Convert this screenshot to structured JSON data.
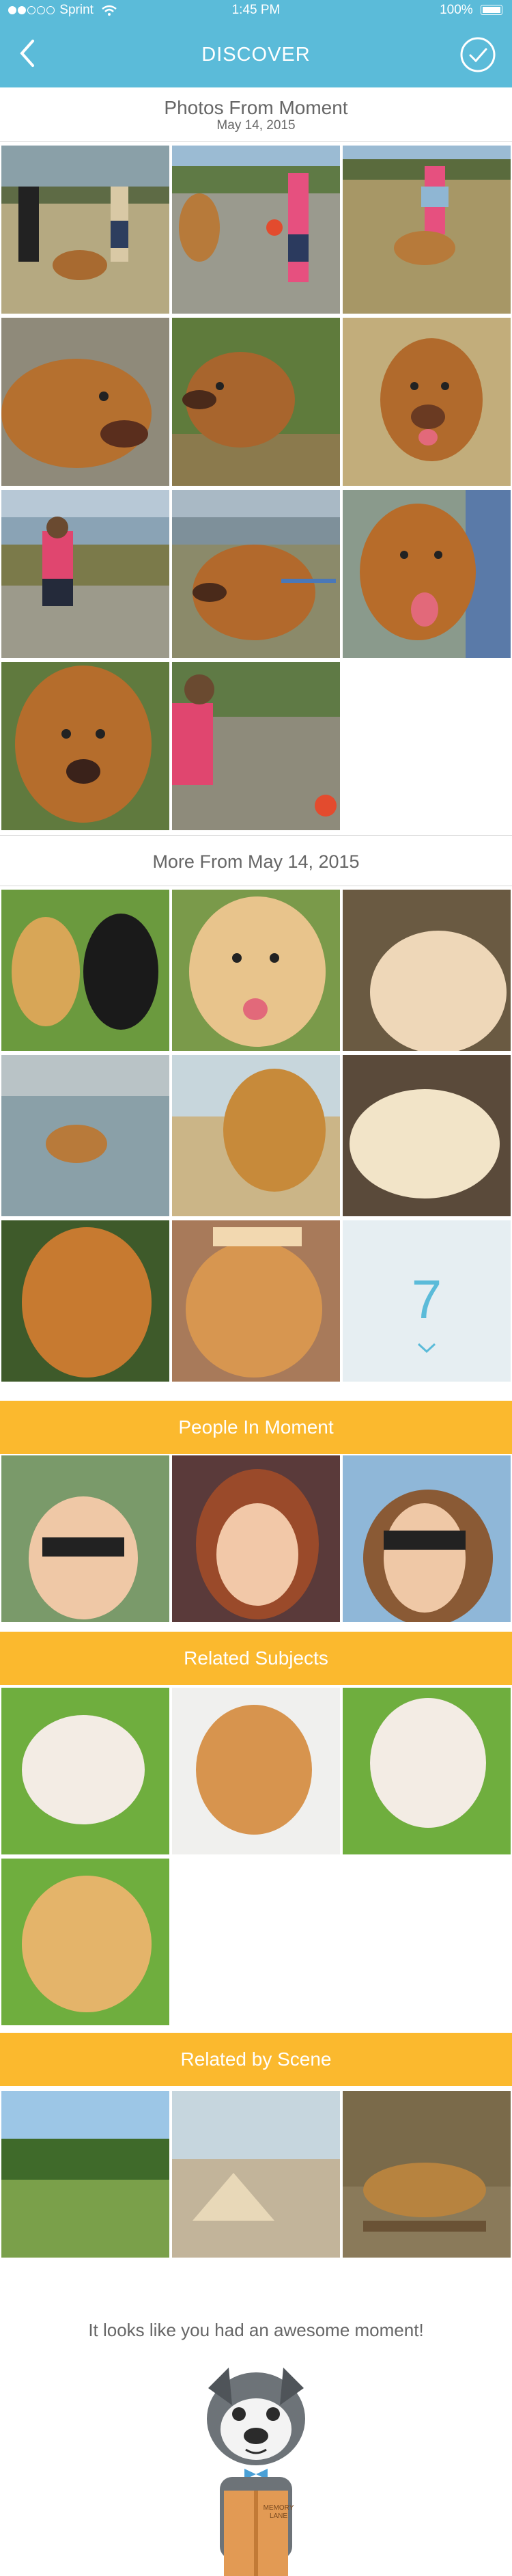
{
  "status_bar": {
    "carrier": "Sprint",
    "time": "1:45 PM",
    "battery": "100%"
  },
  "nav": {
    "title": "DISCOVER",
    "back_icon": "chevron-left-icon",
    "done_icon": "check-circle-icon"
  },
  "sections": {
    "moment": {
      "title": "Photos From Moment",
      "date": "May 14, 2015"
    },
    "more": {
      "title": "More From May 14, 2015",
      "more_count": "7"
    },
    "people": {
      "title": "People In Moment"
    },
    "related_subjects": {
      "title": "Related Subjects"
    },
    "related_scene": {
      "title": "Related by Scene"
    }
  },
  "footer": {
    "message": "It looks like you had an awesome moment!",
    "book_text": "MEMORY LANE"
  },
  "colors": {
    "brand_blue": "#5bbbd9",
    "banner_yellow": "#fbb92e"
  }
}
